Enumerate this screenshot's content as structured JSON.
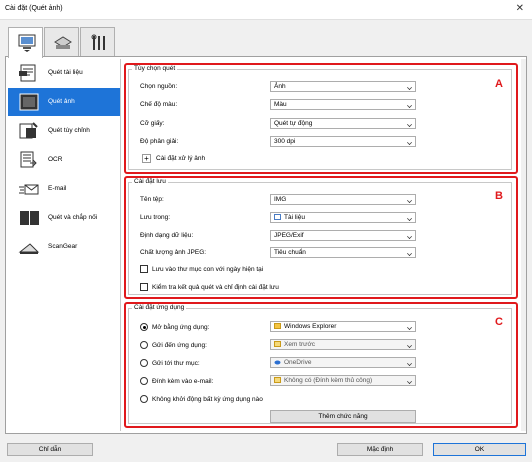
{
  "window": {
    "title": "Cài đặt (Quét ảnh)"
  },
  "sidebar": {
    "items": [
      {
        "label": "Quét tài liệu"
      },
      {
        "label": "Quét ảnh"
      },
      {
        "label": "Quét tùy chỉnh"
      },
      {
        "label": "OCR"
      },
      {
        "label": "E-mail"
      },
      {
        "label": "Quét và chắp nối"
      },
      {
        "label": "ScanGear"
      }
    ]
  },
  "scan_options": {
    "legend": "Tùy chọn quét",
    "marker": "A",
    "rows": [
      {
        "label": "Chọn nguồn:",
        "value": "Ảnh"
      },
      {
        "label": "Chế độ màu:",
        "value": "Màu"
      },
      {
        "label": "Cỡ giấy:",
        "value": "Quét tự động"
      },
      {
        "label": "Độ phân giải:",
        "value": "300 dpi"
      }
    ],
    "image_processing": "Cài đặt xử lý ảnh"
  },
  "save_settings": {
    "legend": "Cài đặt lưu",
    "marker": "B",
    "rows": [
      {
        "label": "Tên tệp:",
        "value": "IMG"
      },
      {
        "label": "Lưu trong:",
        "value": "Tài liệu"
      },
      {
        "label": "Định dạng dữ liệu:",
        "value": "JPEG/Exif"
      },
      {
        "label": "Chất lượng ảnh JPEG:",
        "value": "Tiêu chuẩn"
      }
    ],
    "check1": "Lưu vào thư mục con với ngày hiện tại",
    "check2": "Kiểm tra kết quả quét và chỉ định cài đặt lưu"
  },
  "app_settings": {
    "legend": "Cài đặt ứng dụng",
    "marker": "C",
    "rows": [
      {
        "label": "Mở bằng ứng dụng:",
        "value": "Windows Explorer",
        "selected": true
      },
      {
        "label": "Gửi đến ứng dụng:",
        "value": "Xem trước",
        "selected": false
      },
      {
        "label": "Gửi tới thư mục:",
        "value": "OneDrive",
        "selected": false
      },
      {
        "label": "Đính kèm vào e-mail:",
        "value": "Không có (Đính kèm thủ công)",
        "selected": false
      }
    ],
    "no_app": "Không khởi động bất kỳ ứng dụng nào",
    "more_functions": "Thêm chức năng"
  },
  "footer": {
    "help": "Chỉ dẫn",
    "defaults": "Mặc định",
    "ok": "OK"
  },
  "colors": {
    "accent": "#1e74d8",
    "marker": "#e0191c"
  }
}
